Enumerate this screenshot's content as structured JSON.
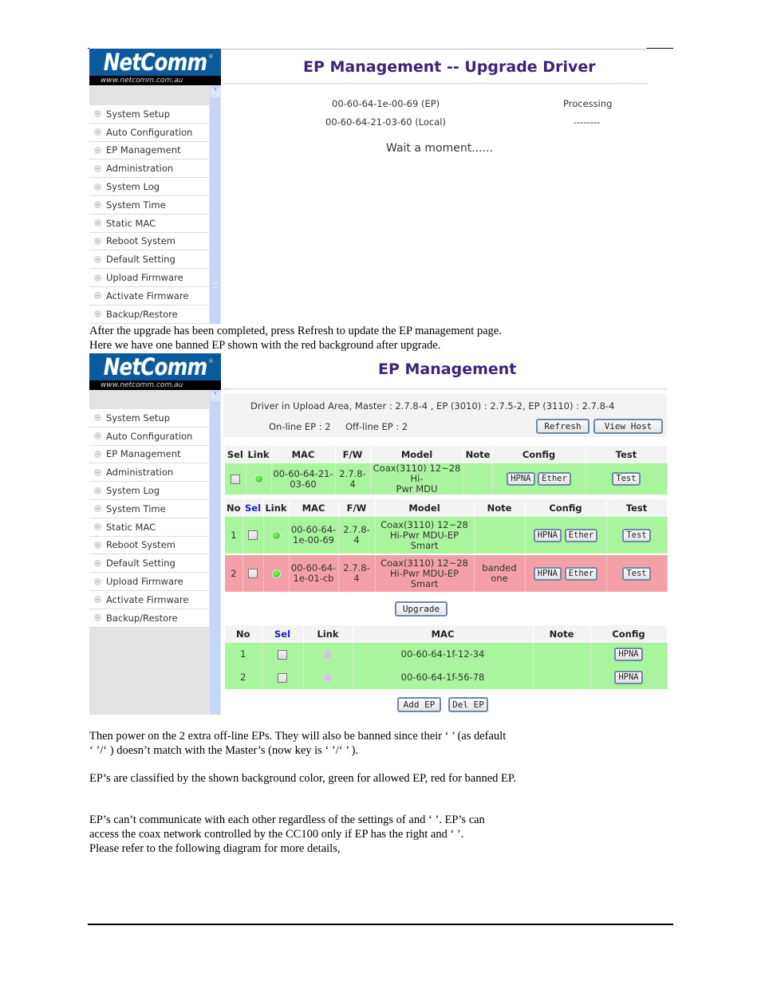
{
  "document": {
    "paragraphs": [
      "After the upgrade has been completed, press Refresh to update the EP management page.",
      "Here we have one banned EP shown with the red background after upgrade.",
      "Then power on the 2 extra off-line EPs. They will also be banned since their ‘                              ’ (as default",
      "‘        ’/‘       ) doesn’t match with the Master’s (now key is ‘      ’/‘           ’ ).",
      "EP’s are classified by the shown background color, green for allowed EP, red for banned EP.",
      "EP’s can’t communicate with each other regardless of the settings of                           and ‘                    ’. EP’s can",
      "access the coax network controlled by the CC100 only if EP has the right                           and ‘                   ’.",
      "Please refer to the following diagram for more details,"
    ]
  },
  "brand": {
    "logo_text": "NetComm",
    "logo_reg": "®",
    "logo_url": "www.netcomm.com.au",
    "color_blue": "#0b5a9e",
    "color_title": "#3d237a"
  },
  "sidebar": {
    "items": [
      "System Setup",
      "Auto Configuration",
      "EP Management",
      "Administration",
      "System Log",
      "System Time",
      "Static MAC",
      "Reboot System",
      "Default Setting",
      "Upload Firmware",
      "Activate Firmware",
      "Backup/Restore"
    ],
    "scroll_up_icon": "˄"
  },
  "screen1": {
    "title": "EP Management -- Upgrade Driver",
    "rows": [
      {
        "mac": "00-60-64-1e-00-69 (EP)",
        "status": "Processing"
      },
      {
        "mac": "00-60-64-21-03-60 (Local)",
        "status": "--------"
      }
    ],
    "wait": "Wait a moment......"
  },
  "screen2": {
    "title": "EP Management",
    "driver_info": "Driver in Upload Area, Master : 2.7.8-4 ,   EP (3010) : 2.7.5-2,   EP (3110) : 2.7.8-4",
    "online_label": "On-line EP : 2",
    "offline_label": "Off-line EP : 2",
    "refresh_button": "Refresh",
    "view_host_button": "View Host",
    "local_table": {
      "headers": [
        "Sel",
        "Link",
        "MAC",
        "F/W",
        "Model",
        "Note",
        "Config",
        "Test"
      ],
      "rows": [
        {
          "mac": [
            "00-60-64-21-",
            "03-60"
          ],
          "fw": [
            "2.7.8-",
            "4"
          ],
          "model": [
            "Coax(3110) 12~28 Hi-",
            "Pwr MDU"
          ],
          "note": "",
          "link": "on",
          "status": "allowed"
        }
      ]
    },
    "online_table": {
      "headers": [
        "No",
        "Sel",
        "Link",
        "MAC",
        "F/W",
        "Model",
        "Note",
        "Config",
        "Test"
      ],
      "rows": [
        {
          "no": "1",
          "mac": [
            "00-60-64-",
            "1e-00-69"
          ],
          "fw": [
            "2.7.8-",
            "4"
          ],
          "model": [
            "Coax(3110) 12~28",
            "Hi-Pwr MDU-EP",
            "Smart"
          ],
          "note": [
            "",
            ""
          ],
          "link": "on",
          "status": "allowed"
        },
        {
          "no": "2",
          "mac": [
            "00-60-64-",
            "1e-01-cb"
          ],
          "fw": [
            "2.7.8-",
            "4"
          ],
          "model": [
            "Coax(3110) 12~28",
            "Hi-Pwr MDU-EP",
            "Smart"
          ],
          "note": [
            "banded",
            "one"
          ],
          "link": "on",
          "status": "banned"
        }
      ]
    },
    "upgrade_button": "Upgrade",
    "offline_table": {
      "headers": [
        "No",
        "Sel",
        "Link",
        "MAC",
        "Note",
        "Config"
      ],
      "rows": [
        {
          "no": "1",
          "mac": "00-60-64-1f-12-34",
          "note": "",
          "link": "off"
        },
        {
          "no": "2",
          "mac": "00-60-64-1f-56-78",
          "note": "",
          "link": "off"
        }
      ]
    },
    "add_ep_button": "Add EP",
    "del_ep_button": "Del EP",
    "btn_hpna": "HPNA",
    "btn_ether": "Ether",
    "btn_test": "Test"
  },
  "colors": {
    "allowed_row": "#a9f59d",
    "banned_row": "#f4a0a8",
    "header_bg": "#f3f3f3",
    "sel_header": "#1c1ccc"
  }
}
